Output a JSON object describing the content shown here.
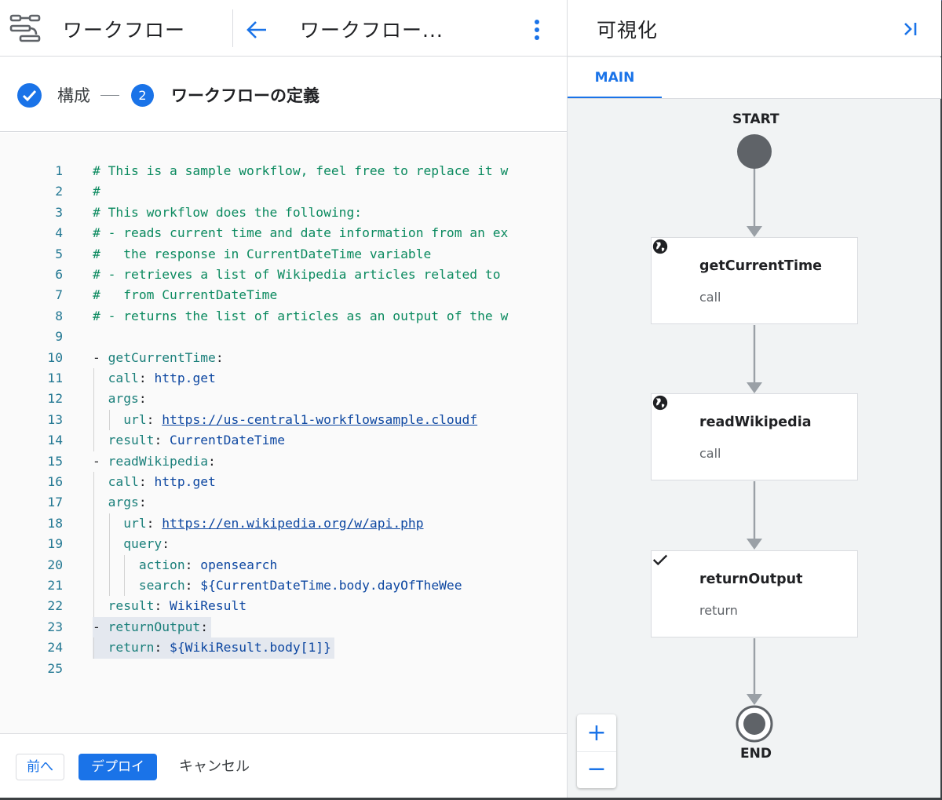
{
  "header": {
    "app_title": "ワークフロー",
    "workflow_title": "ワークフロー...",
    "app_icon": "workflows-icon",
    "back_icon": "arrow-back-icon",
    "menu_icon": "more-vert-icon"
  },
  "stepper": {
    "step1_label": "構成",
    "step2_number": "2",
    "step2_label": "ワークフローの定義",
    "step1_icon": "check-circle-icon"
  },
  "editor": {
    "lines": [
      {
        "n": "1",
        "indent": 0,
        "parts": [
          {
            "t": "# This is a sample workflow, feel free to replace it w",
            "c": "comment"
          }
        ]
      },
      {
        "n": "2",
        "indent": 0,
        "parts": [
          {
            "t": "#",
            "c": "comment"
          }
        ]
      },
      {
        "n": "3",
        "indent": 0,
        "parts": [
          {
            "t": "# This workflow does the following:",
            "c": "comment"
          }
        ]
      },
      {
        "n": "4",
        "indent": 0,
        "parts": [
          {
            "t": "# - reads current time and date information from an ex",
            "c": "comment"
          }
        ]
      },
      {
        "n": "5",
        "indent": 0,
        "parts": [
          {
            "t": "#   the response in CurrentDateTime variable",
            "c": "comment"
          }
        ]
      },
      {
        "n": "6",
        "indent": 0,
        "parts": [
          {
            "t": "# - retrieves a list of Wikipedia articles related to",
            "c": "comment"
          }
        ]
      },
      {
        "n": "7",
        "indent": 0,
        "parts": [
          {
            "t": "#   from CurrentDateTime",
            "c": "comment"
          }
        ]
      },
      {
        "n": "8",
        "indent": 0,
        "parts": [
          {
            "t": "# - returns the list of articles as an output of the w",
            "c": "comment"
          }
        ]
      },
      {
        "n": "9",
        "indent": 0,
        "parts": []
      },
      {
        "n": "10",
        "indent": 0,
        "parts": [
          {
            "t": "- ",
            "c": "plain"
          },
          {
            "t": "getCurrentTime",
            "c": "key"
          },
          {
            "t": ":",
            "c": "plain"
          }
        ]
      },
      {
        "n": "11",
        "indent": 2,
        "parts": [
          {
            "t": "call",
            "c": "key"
          },
          {
            "t": ": ",
            "c": "plain"
          },
          {
            "t": "http.get",
            "c": "val"
          }
        ]
      },
      {
        "n": "12",
        "indent": 2,
        "parts": [
          {
            "t": "args",
            "c": "key"
          },
          {
            "t": ":",
            "c": "plain"
          }
        ]
      },
      {
        "n": "13",
        "indent": 4,
        "parts": [
          {
            "t": "url",
            "c": "key"
          },
          {
            "t": ": ",
            "c": "plain"
          },
          {
            "t": "https://us-central1-workflowsample.cloudf",
            "c": "url"
          }
        ]
      },
      {
        "n": "14",
        "indent": 2,
        "parts": [
          {
            "t": "result",
            "c": "key"
          },
          {
            "t": ": ",
            "c": "plain"
          },
          {
            "t": "CurrentDateTime",
            "c": "val"
          }
        ]
      },
      {
        "n": "15",
        "indent": 0,
        "parts": [
          {
            "t": "- ",
            "c": "plain"
          },
          {
            "t": "readWikipedia",
            "c": "key"
          },
          {
            "t": ":",
            "c": "plain"
          }
        ]
      },
      {
        "n": "16",
        "indent": 2,
        "parts": [
          {
            "t": "call",
            "c": "key"
          },
          {
            "t": ": ",
            "c": "plain"
          },
          {
            "t": "http.get",
            "c": "val"
          }
        ]
      },
      {
        "n": "17",
        "indent": 2,
        "parts": [
          {
            "t": "args",
            "c": "key"
          },
          {
            "t": ":",
            "c": "plain"
          }
        ]
      },
      {
        "n": "18",
        "indent": 4,
        "parts": [
          {
            "t": "url",
            "c": "key"
          },
          {
            "t": ": ",
            "c": "plain"
          },
          {
            "t": "https://en.wikipedia.org/w/api.php",
            "c": "url"
          }
        ]
      },
      {
        "n": "19",
        "indent": 4,
        "parts": [
          {
            "t": "query",
            "c": "key"
          },
          {
            "t": ":",
            "c": "plain"
          }
        ]
      },
      {
        "n": "20",
        "indent": 6,
        "parts": [
          {
            "t": "action",
            "c": "key"
          },
          {
            "t": ": ",
            "c": "plain"
          },
          {
            "t": "opensearch",
            "c": "val"
          }
        ]
      },
      {
        "n": "21",
        "indent": 6,
        "parts": [
          {
            "t": "search",
            "c": "key"
          },
          {
            "t": ": ",
            "c": "plain"
          },
          {
            "t": "${CurrentDateTime.body.dayOfTheWee",
            "c": "val"
          }
        ]
      },
      {
        "n": "22",
        "indent": 2,
        "parts": [
          {
            "t": "result",
            "c": "key"
          },
          {
            "t": ": ",
            "c": "plain"
          },
          {
            "t": "WikiResult",
            "c": "val"
          }
        ]
      },
      {
        "n": "23",
        "indent": 0,
        "hl": true,
        "parts": [
          {
            "t": "- ",
            "c": "plain"
          },
          {
            "t": "returnOutput",
            "c": "key"
          },
          {
            "t": ":",
            "c": "plain"
          }
        ]
      },
      {
        "n": "24",
        "indent": 2,
        "hl": true,
        "parts": [
          {
            "t": "return",
            "c": "key"
          },
          {
            "t": ": ",
            "c": "plain"
          },
          {
            "t": "${WikiResult.body[1]}",
            "c": "val"
          }
        ]
      },
      {
        "n": "25",
        "indent": 0,
        "parts": []
      }
    ]
  },
  "footer": {
    "prev_label": "前へ",
    "deploy_label": "デプロイ",
    "cancel_label": "キャンセル"
  },
  "visualization": {
    "title": "可視化",
    "collapse_icon": "collapse-right-icon",
    "tab_label": "MAIN",
    "start_label": "START",
    "end_label": "END",
    "nodes": [
      {
        "name": "getCurrentTime",
        "type": "call",
        "icon": "globe-icon"
      },
      {
        "name": "readWikipedia",
        "type": "call",
        "icon": "globe-icon"
      },
      {
        "name": "returnOutput",
        "type": "return",
        "icon": "check-icon"
      }
    ],
    "zoom_in_label": "+",
    "zoom_out_label": "−"
  },
  "colors": {
    "accent": "#1a73e8",
    "comment": "#0b8a5f",
    "key": "#1a7f7a",
    "value": "#0d47a1"
  }
}
